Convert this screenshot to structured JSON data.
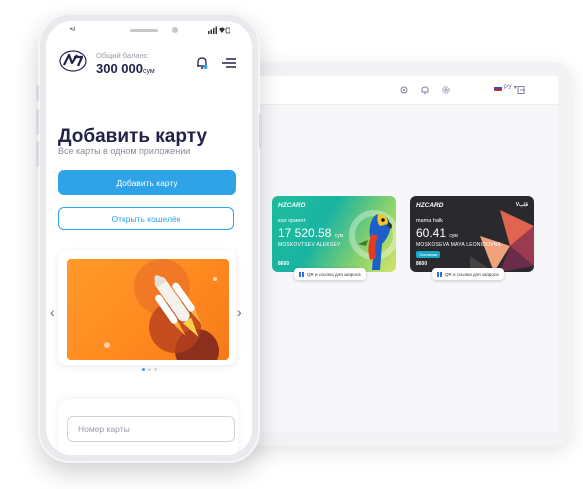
{
  "desktop": {
    "language": "РУ",
    "cards": [
      {
        "brand": "HZCARD",
        "name": "кон ориент",
        "amount": "17 520.58",
        "currency": "сум",
        "holder": "MOSKOVTSEV ALEKSEY",
        "number": "8600",
        "qr_label": "QR и ссылка для запроса"
      },
      {
        "brand": "HZCARD",
        "brand_right": "Vقلب",
        "name": "mama halk",
        "amount": "60.41",
        "currency": "сум",
        "holder": "MOSKOSEVA MAYA LEONIDOVNA",
        "badge": "Основная",
        "number": "8600",
        "qr_label": "QR и ссылка для запроса"
      }
    ]
  },
  "phone": {
    "status_left": "•ıl",
    "header": {
      "balance_label": "Общий баланс:",
      "balance_amount": "300 000",
      "balance_currency": "сум"
    },
    "title": "Добавить карту",
    "subtitle": "Все карты в одном приложении",
    "add_card_button": "Добавить карту",
    "open_wallet_button": "Открыть кошелёк",
    "carousel": {
      "prev": "‹",
      "next": "›",
      "slides": 3,
      "active": 1
    },
    "card_number_placeholder": "Номер карты"
  },
  "colors": {
    "primary": "#2ea3e8",
    "title": "#23234a",
    "promo_orange": "#ff8a1f"
  }
}
